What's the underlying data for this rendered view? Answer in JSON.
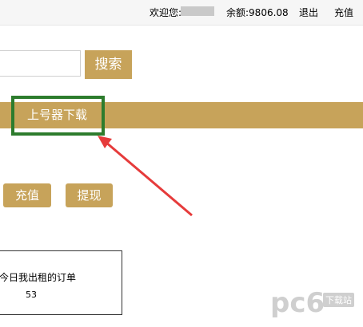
{
  "topbar": {
    "welcome": "欢迎您:",
    "balance": "余额:9806.08",
    "logout": "退出",
    "recharge": "充值"
  },
  "search": {
    "value": "",
    "button": "搜索"
  },
  "nav": {
    "download": "上号器下载"
  },
  "actions": {
    "recharge": "充值",
    "withdraw": "提现"
  },
  "orders": {
    "title": "今日我出租的订单",
    "count": "53"
  },
  "watermark": {
    "logo": "pc6",
    "sub": "下载站"
  },
  "colors": {
    "accent": "#c7a35a",
    "highlight_box": "#2d7c2d",
    "arrow": "#e63b3b"
  }
}
